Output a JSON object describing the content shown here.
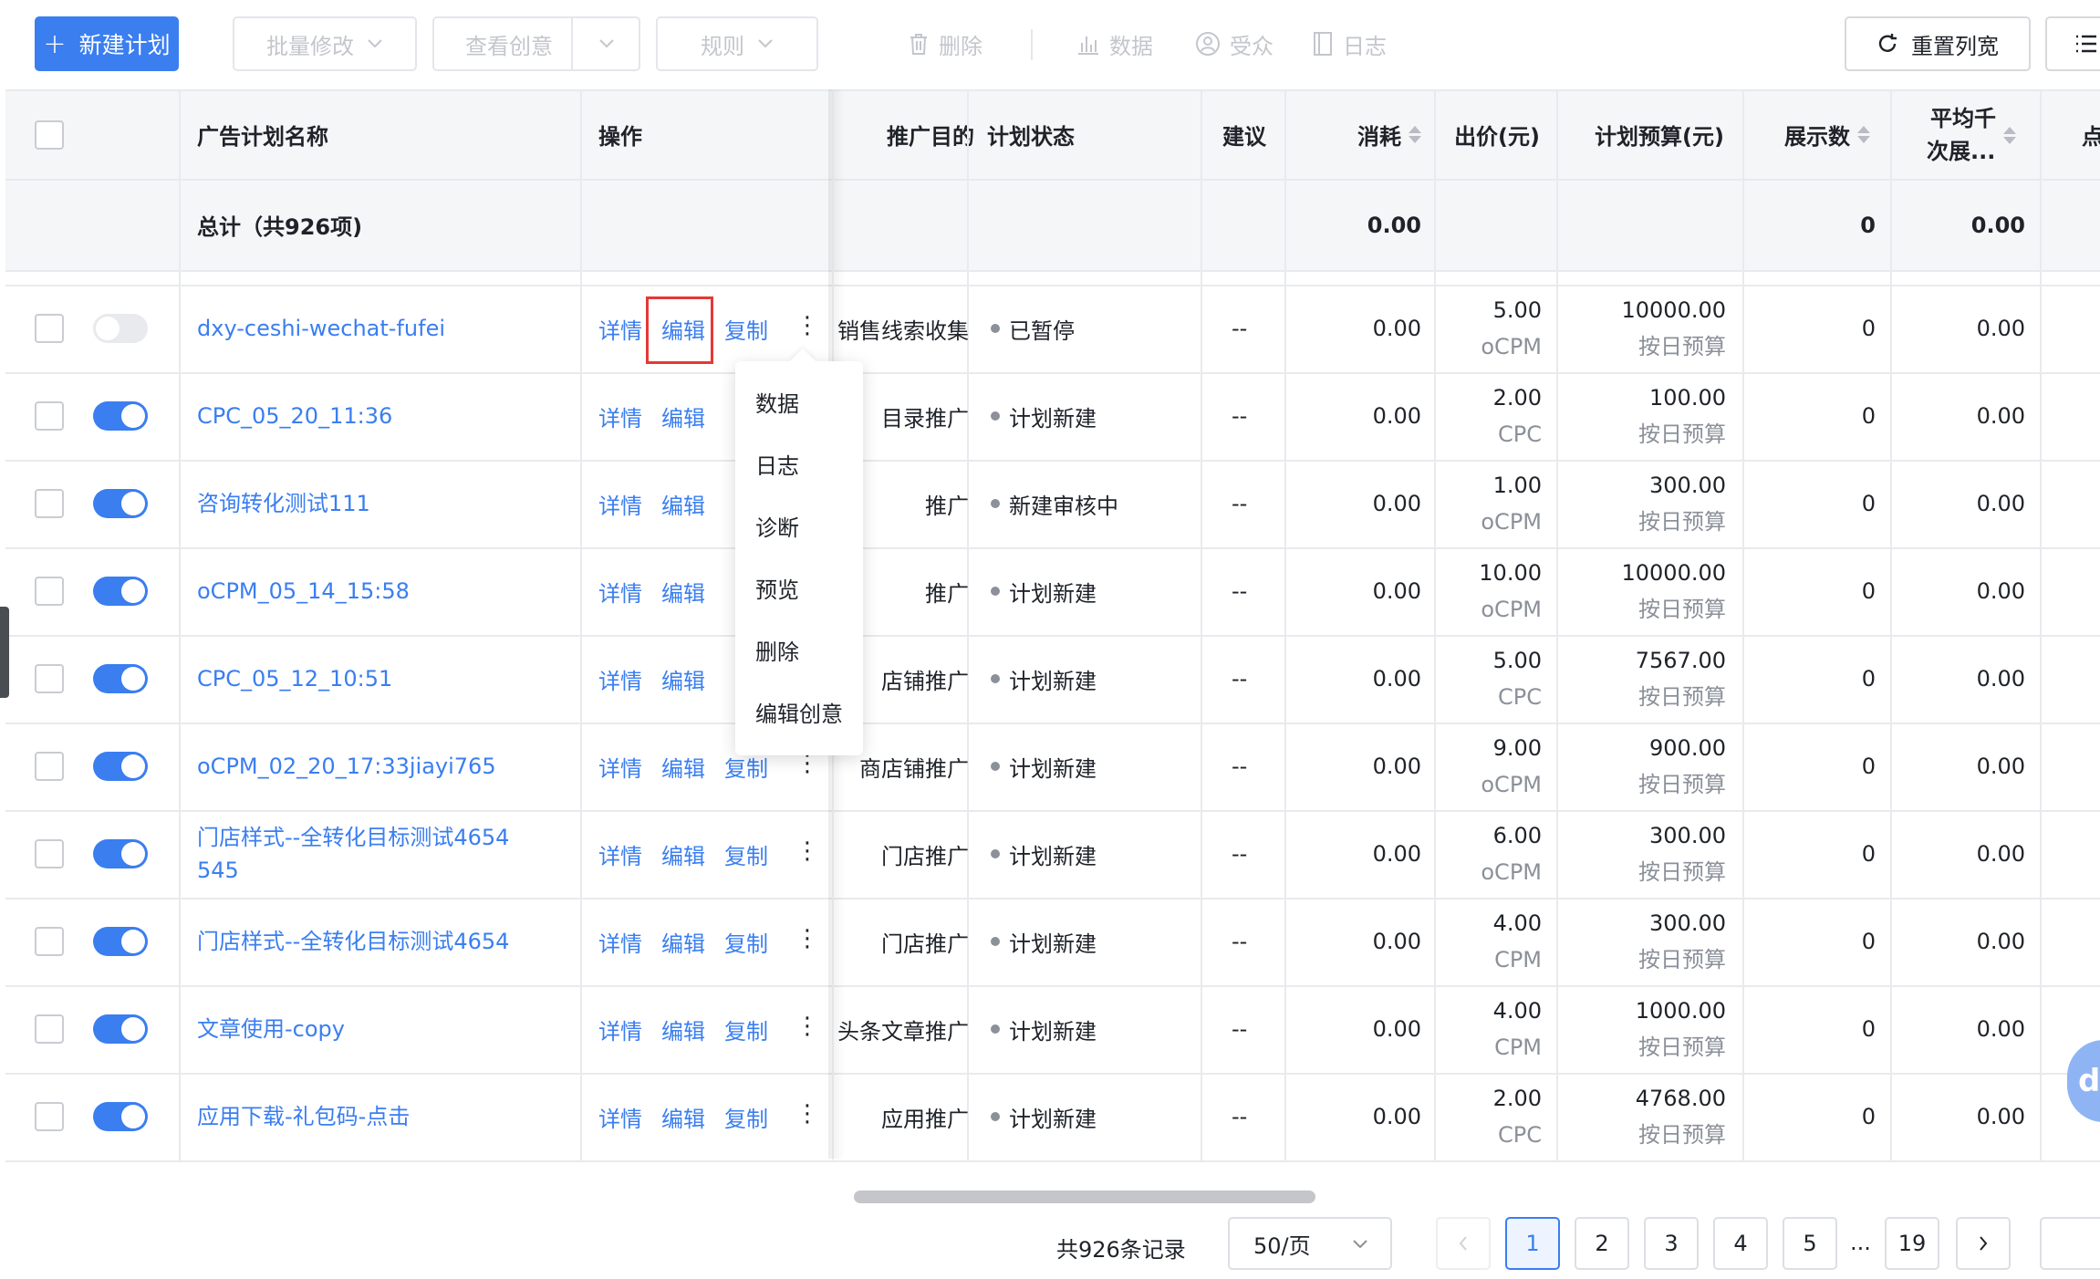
{
  "toolbar": {
    "new_plan": "新建计划",
    "batch_edit": "批量修改",
    "view_creative": "查看创意",
    "rules": "规则",
    "delete": "删除",
    "data": "数据",
    "audience": "受众",
    "log": "日志",
    "reset_width": "重置列宽"
  },
  "columns": {
    "name": "广告计划名称",
    "action": "操作",
    "purpose": "推广目的",
    "status": "计划状态",
    "suggest": "建议",
    "cost": "消耗",
    "bid": "出价(元)",
    "budget": "计划预算(元)",
    "impressions": "展示数",
    "cpm_line1": "平均千",
    "cpm_line2": "次展...",
    "click": "点"
  },
  "total": {
    "label": "总计（共926项)",
    "cost": "0.00",
    "impressions": "0",
    "cpm": "0.00"
  },
  "actions": {
    "detail": "详情",
    "edit": "编辑",
    "copy": "复制",
    "more": "⋮"
  },
  "rows": [
    {
      "on": false,
      "name": "dxy-ceshi-wechat-fufei",
      "name2": "",
      "purpose": "销售线索收集",
      "status": "已暂停",
      "suggest": "--",
      "cost": "0.00",
      "bid": "5.00",
      "bid_type": "oCPM",
      "budget": "10000.00",
      "budget_type": "按日预算",
      "impressions": "0",
      "cpm": "0.00"
    },
    {
      "on": true,
      "name": "CPC_05_20_11:36",
      "name2": "",
      "purpose": "目录推广",
      "status": "计划新建",
      "suggest": "--",
      "cost": "0.00",
      "bid": "2.00",
      "bid_type": "CPC",
      "budget": "100.00",
      "budget_type": "按日预算",
      "impressions": "0",
      "cpm": "0.00"
    },
    {
      "on": true,
      "name": "咨询转化测试111",
      "name2": "",
      "purpose": "推广",
      "status": "新建审核中",
      "suggest": "--",
      "cost": "0.00",
      "bid": "1.00",
      "bid_type": "oCPM",
      "budget": "300.00",
      "budget_type": "按日预算",
      "impressions": "0",
      "cpm": "0.00"
    },
    {
      "on": true,
      "name": "oCPM_05_14_15:58",
      "name2": "",
      "purpose": "推广",
      "status": "计划新建",
      "suggest": "--",
      "cost": "0.00",
      "bid": "10.00",
      "bid_type": "oCPM",
      "budget": "10000.00",
      "budget_type": "按日预算",
      "impressions": "0",
      "cpm": "0.00"
    },
    {
      "on": true,
      "name": "CPC_05_12_10:51",
      "name2": "",
      "purpose": "店铺推广",
      "status": "计划新建",
      "suggest": "--",
      "cost": "0.00",
      "bid": "5.00",
      "bid_type": "CPC",
      "budget": "7567.00",
      "budget_type": "按日预算",
      "impressions": "0",
      "cpm": "0.00"
    },
    {
      "on": true,
      "name": "oCPM_02_20_17:33jiayi765",
      "name2": "",
      "purpose": "商店铺推广",
      "status": "计划新建",
      "suggest": "--",
      "cost": "0.00",
      "bid": "9.00",
      "bid_type": "oCPM",
      "budget": "900.00",
      "budget_type": "按日预算",
      "impressions": "0",
      "cpm": "0.00"
    },
    {
      "on": true,
      "name": "门店样式--全转化目标测试4654",
      "name2": "545",
      "purpose": "门店推广",
      "status": "计划新建",
      "suggest": "--",
      "cost": "0.00",
      "bid": "6.00",
      "bid_type": "oCPM",
      "budget": "300.00",
      "budget_type": "按日预算",
      "impressions": "0",
      "cpm": "0.00"
    },
    {
      "on": true,
      "name": "门店样式--全转化目标测试4654",
      "name2": "",
      "purpose": "门店推广",
      "status": "计划新建",
      "suggest": "--",
      "cost": "0.00",
      "bid": "4.00",
      "bid_type": "CPM",
      "budget": "300.00",
      "budget_type": "按日预算",
      "impressions": "0",
      "cpm": "0.00"
    },
    {
      "on": true,
      "name": "文章使用-copy",
      "name2": "",
      "purpose": "头条文章推广",
      "status": "计划新建",
      "suggest": "--",
      "cost": "0.00",
      "bid": "4.00",
      "bid_type": "CPM",
      "budget": "1000.00",
      "budget_type": "按日预算",
      "impressions": "0",
      "cpm": "0.00"
    },
    {
      "on": true,
      "name": "应用下载-礼包码-点击",
      "name2": "",
      "purpose": "应用推广",
      "status": "计划新建",
      "suggest": "--",
      "cost": "0.00",
      "bid": "2.00",
      "bid_type": "CPC",
      "budget": "4768.00",
      "budget_type": "按日预算",
      "impressions": "0",
      "cpm": "0.00"
    }
  ],
  "menu": [
    "数据",
    "日志",
    "诊断",
    "预览",
    "删除",
    "编辑创意"
  ],
  "pagination": {
    "total_text": "共926条记录",
    "page_size": "50/页",
    "pages": [
      "1",
      "2",
      "3",
      "4",
      "5"
    ],
    "ellipsis": "...",
    "last": "19",
    "current": "1"
  },
  "icons": {
    "plus": "plus-icon",
    "chevron": "chevron-down-icon",
    "trash": "trash-icon",
    "bar_chart": "bar-chart-icon",
    "audience": "audience-icon",
    "log": "log-icon",
    "refresh": "refresh-icon",
    "list": "list-icon"
  },
  "colors": {
    "accent": "#3a7ef0",
    "highlight": "#e53935"
  }
}
